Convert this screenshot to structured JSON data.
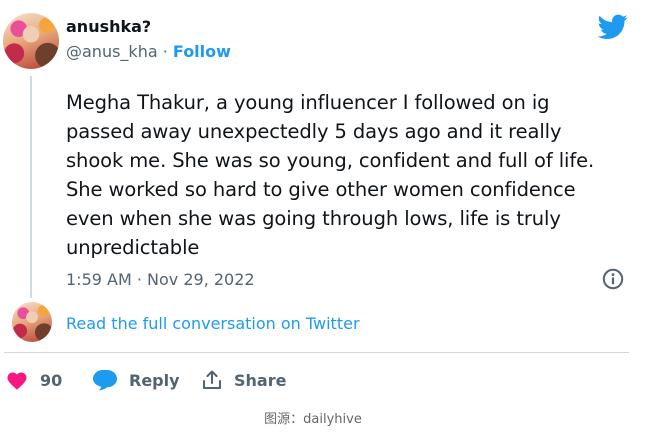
{
  "tweet": {
    "display_name": "anushka?",
    "handle": "@anus_kha",
    "separator": " · ",
    "follow_label": "Follow",
    "text": "Megha Thakur, a young influencer I followed on ig passed away unexpectedly 5 days ago and it really shook me. She was so young, confident and full of life. She worked so hard to give other women confidence even when she was going through lows, life is truly unpredictable",
    "timestamp": "1:59 AM · Nov 29, 2022",
    "read_more_label": "Read the full conversation on Twitter"
  },
  "actions": {
    "like_count": "90",
    "reply_label": "Reply",
    "share_label": "Share"
  },
  "caption": "图源：dailyhive",
  "icons": {
    "brand": "twitter-bird-icon",
    "info": "info-icon",
    "like": "heart-icon",
    "reply": "speech-bubble-icon",
    "share": "share-upload-icon"
  },
  "colors": {
    "accent": "#1d9bf0",
    "like": "#f91880",
    "muted": "#536471",
    "text": "#0f1419"
  }
}
